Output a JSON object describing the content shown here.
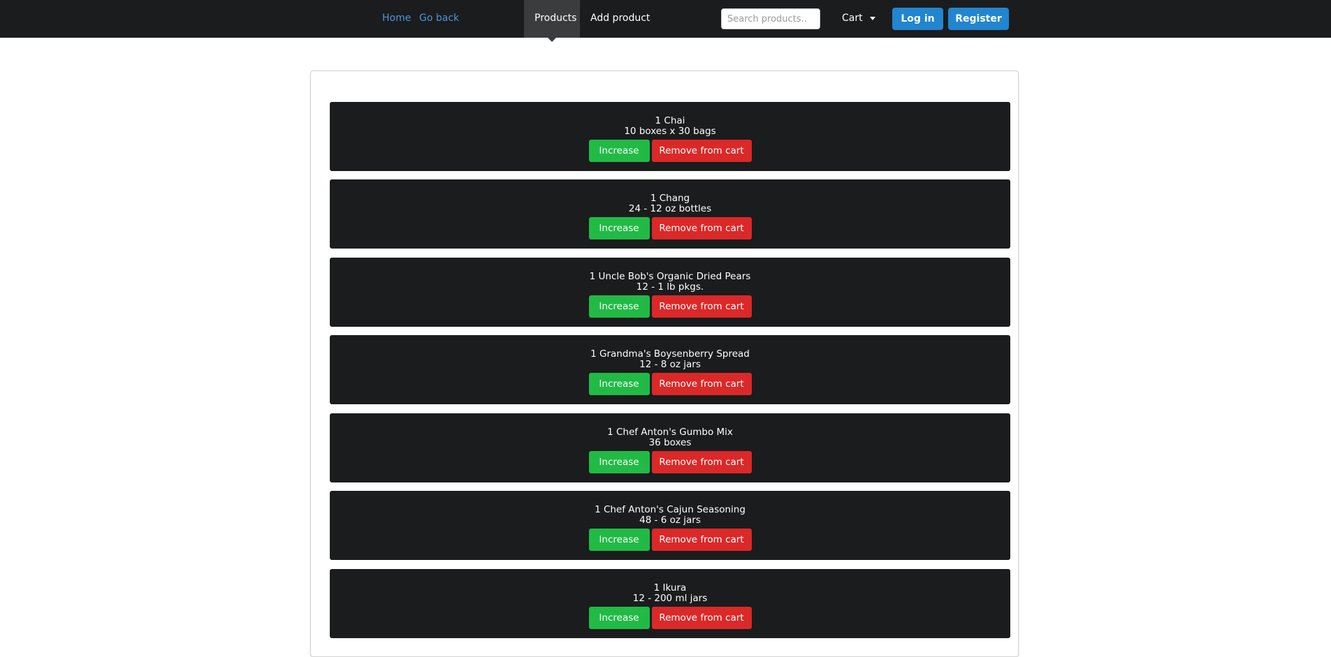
{
  "nav": {
    "home": "Home",
    "go_back": "Go back",
    "products": "Products",
    "add_product": "Add product",
    "search_placeholder": "Search products..",
    "cart": "Cart",
    "login": "Log in",
    "register": "Register"
  },
  "colors": {
    "navbar_bg": "#1b1c1d",
    "link_blue": "#4c95d6",
    "primary_button": "#2185d0",
    "increase_button": "#21ba45",
    "remove_button": "#db2828",
    "item_bg": "#1b1c1d"
  },
  "cart_items": [
    {
      "name": "1 Chai",
      "quantity_per_unit": "10 boxes x 30 bags",
      "increase_label": "Increase",
      "remove_label": "Remove from cart"
    },
    {
      "name": "1 Chang",
      "quantity_per_unit": "24 - 12 oz bottles",
      "increase_label": "Increase",
      "remove_label": "Remove from cart"
    },
    {
      "name": "1 Uncle Bob's Organic Dried Pears",
      "quantity_per_unit": "12 - 1 lb pkgs.",
      "increase_label": "Increase",
      "remove_label": "Remove from cart"
    },
    {
      "name": "1 Grandma's Boysenberry Spread",
      "quantity_per_unit": "12 - 8 oz jars",
      "increase_label": "Increase",
      "remove_label": "Remove from cart"
    },
    {
      "name": "1 Chef Anton's Gumbo Mix",
      "quantity_per_unit": "36 boxes",
      "increase_label": "Increase",
      "remove_label": "Remove from cart"
    },
    {
      "name": "1 Chef Anton's Cajun Seasoning",
      "quantity_per_unit": "48 - 6 oz jars",
      "increase_label": "Increase",
      "remove_label": "Remove from cart"
    },
    {
      "name": "1 Ikura",
      "quantity_per_unit": "12 - 200 ml jars",
      "increase_label": "Increase",
      "remove_label": "Remove from cart"
    }
  ]
}
